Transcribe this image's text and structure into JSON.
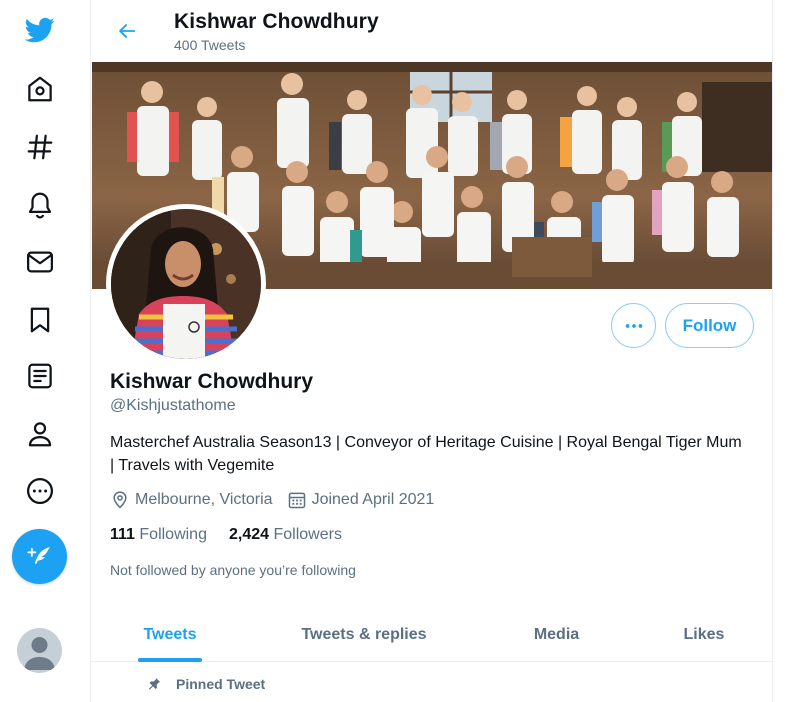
{
  "colors": {
    "accent": "#1da1f2",
    "text_primary": "#0f1419",
    "text_secondary": "#5b7083"
  },
  "nav": {
    "items": [
      {
        "name": "twitter-logo-icon"
      },
      {
        "name": "home-icon"
      },
      {
        "name": "explore-hashtag-icon"
      },
      {
        "name": "notifications-bell-icon"
      },
      {
        "name": "messages-envelope-icon"
      },
      {
        "name": "bookmarks-icon"
      },
      {
        "name": "lists-icon"
      },
      {
        "name": "profile-person-icon"
      },
      {
        "name": "more-circle-icon"
      }
    ],
    "compose_icon": "feather-plus-icon",
    "avatar_icon": "default-avatar-icon"
  },
  "header": {
    "name": "Kishwar Chowdhury",
    "tweet_count": "400 Tweets"
  },
  "profile": {
    "name": "Kishwar Chowdhury",
    "handle": "@Kishjustathome",
    "bio": "Masterchef Australia Season13 | Conveyor of Heritage Cuisine | Royal Bengal Tiger Mum | Travels with Vegemite",
    "location": "Melbourne, Victoria",
    "joined": "Joined April 2021",
    "following_count": "111",
    "following_label": "Following",
    "followers_count": "2,424",
    "followers_label": "Followers",
    "not_followed": "Not followed by anyone you’re following",
    "follow_label": "Follow"
  },
  "tabs": [
    {
      "label": "Tweets",
      "active": true
    },
    {
      "label": "Tweets & replies",
      "active": false
    },
    {
      "label": "Media",
      "active": false
    },
    {
      "label": "Likes",
      "active": false
    }
  ],
  "pinned_label": "Pinned Tweet"
}
